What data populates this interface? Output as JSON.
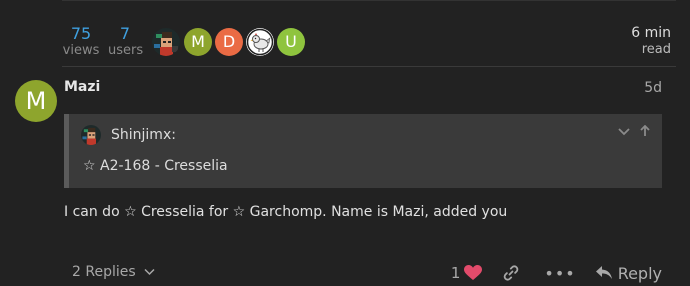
{
  "stats": {
    "views": {
      "value": "75",
      "label": "views"
    },
    "users": {
      "value": "7",
      "label": "users"
    },
    "read_time": {
      "value": "6 min",
      "label": "read"
    }
  },
  "participants": [
    {
      "type": "image",
      "icon": "pixel-avatar-icon"
    },
    {
      "type": "letter",
      "letter": "M",
      "color": "#8ea52d"
    },
    {
      "type": "letter",
      "letter": "D",
      "color": "#ea6b44"
    },
    {
      "type": "image",
      "icon": "chicken-avatar-icon"
    },
    {
      "type": "letter",
      "letter": "U",
      "color": "#8fc43e"
    }
  ],
  "post": {
    "avatar_letter": "M",
    "avatar_color": "#8ea52d",
    "username": "Mazi",
    "date": "5d",
    "quote": {
      "author": "Shinjimx:",
      "text": "☆ A2-168 - Cresselia"
    },
    "body": "I can do ☆ Cresselia for ☆ Garchomp. Name is Mazi, added you",
    "replies_label": "2 Replies",
    "like_count": "1",
    "reply_label": "Reply"
  }
}
